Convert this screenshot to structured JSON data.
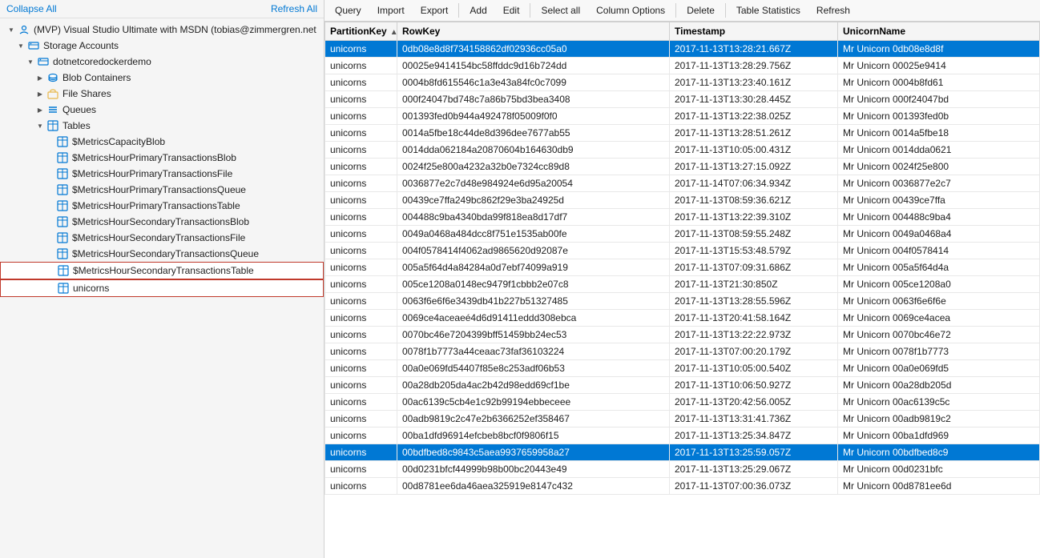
{
  "leftPanel": {
    "collapseAll": "Collapse All",
    "refreshAll": "Refresh All",
    "tree": [
      {
        "id": "mvp-account",
        "label": "(MVP) Visual Studio Ultimate with MSDN (tobias@zimmergren.net",
        "indent": 1,
        "icon": "account",
        "expanded": true,
        "hasArrow": true,
        "arrowDown": true
      },
      {
        "id": "storage-accounts",
        "label": "Storage Accounts",
        "indent": 2,
        "icon": "storage",
        "expanded": true,
        "hasArrow": true,
        "arrowDown": true
      },
      {
        "id": "dotnetcoredockerdemo",
        "label": "dotnetcoredockerdemo",
        "indent": 3,
        "icon": "storage",
        "expanded": true,
        "hasArrow": true,
        "arrowDown": true
      },
      {
        "id": "blob-containers",
        "label": "Blob Containers",
        "indent": 4,
        "icon": "blob",
        "expanded": false,
        "hasArrow": true,
        "arrowDown": false
      },
      {
        "id": "file-shares",
        "label": "File Shares",
        "indent": 4,
        "icon": "share",
        "expanded": false,
        "hasArrow": true,
        "arrowDown": false
      },
      {
        "id": "queues",
        "label": "Queues",
        "indent": 4,
        "icon": "queue",
        "expanded": false,
        "hasArrow": true,
        "arrowDown": false
      },
      {
        "id": "tables",
        "label": "Tables",
        "indent": 4,
        "icon": "table",
        "expanded": true,
        "hasArrow": true,
        "arrowDown": true
      },
      {
        "id": "t1",
        "label": "$MetricsCapacityBlob",
        "indent": 5,
        "icon": "table",
        "hasArrow": false
      },
      {
        "id": "t2",
        "label": "$MetricsHourPrimaryTransactionsBlob",
        "indent": 5,
        "icon": "table",
        "hasArrow": false
      },
      {
        "id": "t3",
        "label": "$MetricsHourPrimaryTransactionsFile",
        "indent": 5,
        "icon": "table",
        "hasArrow": false
      },
      {
        "id": "t4",
        "label": "$MetricsHourPrimaryTransactionsQueue",
        "indent": 5,
        "icon": "table",
        "hasArrow": false
      },
      {
        "id": "t5",
        "label": "$MetricsHourPrimaryTransactionsTable",
        "indent": 5,
        "icon": "table",
        "hasArrow": false
      },
      {
        "id": "t6",
        "label": "$MetricsHourSecondaryTransactionsBlob",
        "indent": 5,
        "icon": "table",
        "hasArrow": false
      },
      {
        "id": "t7",
        "label": "$MetricsHourSecondaryTransactionsFile",
        "indent": 5,
        "icon": "table",
        "hasArrow": false
      },
      {
        "id": "t8",
        "label": "$MetricsHourSecondaryTransactionsQueue",
        "indent": 5,
        "icon": "table",
        "hasArrow": false
      },
      {
        "id": "t9",
        "label": "$MetricsHourSecondaryTransactionsTable",
        "indent": 5,
        "icon": "table",
        "hasArrow": false,
        "selected": true
      },
      {
        "id": "unicorns",
        "label": "unicorns",
        "indent": 5,
        "icon": "table",
        "hasArrow": false,
        "highlighted": true
      }
    ]
  },
  "toolbar": {
    "buttons": [
      "Query",
      "Import",
      "Export",
      "Add",
      "Edit",
      "Select all",
      "Column Options",
      "Delete",
      "Table Statistics",
      "Refresh"
    ]
  },
  "table": {
    "columns": [
      {
        "id": "partition",
        "label": "PartitionKey",
        "sortable": true,
        "sortDir": "asc"
      },
      {
        "id": "rowkey",
        "label": "RowKey",
        "sortable": false
      },
      {
        "id": "timestamp",
        "label": "Timestamp",
        "sortable": false
      },
      {
        "id": "unicornname",
        "label": "UnicornName",
        "sortable": false
      }
    ],
    "rows": [
      {
        "partition": "unicorns",
        "rowkey": "0db08e8d8f734158862df02936cc05a0",
        "timestamp": "2017-11-13T13:28:21.667Z",
        "unicornname": "Mr Unicorn 0db08e8d8f",
        "selected": true
      },
      {
        "partition": "unicorns",
        "rowkey": "00025e9414154bc58ffddc9d16b724dd",
        "timestamp": "2017-11-13T13:28:29.756Z",
        "unicornname": "Mr Unicorn 00025e9414"
      },
      {
        "partition": "unicorns",
        "rowkey": "0004b8fd615546c1a3e43a84fc0c7099",
        "timestamp": "2017-11-13T13:23:40.161Z",
        "unicornname": "Mr Unicorn 0004b8fd61"
      },
      {
        "partition": "unicorns",
        "rowkey": "000f24047bd748c7a86b75bd3bea3408",
        "timestamp": "2017-11-13T13:30:28.445Z",
        "unicornname": "Mr Unicorn 000f24047bd"
      },
      {
        "partition": "unicorns",
        "rowkey": "001393fed0b944a492478f05009f0f0",
        "timestamp": "2017-11-13T13:22:38.025Z",
        "unicornname": "Mr Unicorn 001393fed0b"
      },
      {
        "partition": "unicorns",
        "rowkey": "0014a5fbe18c44de8d396dee7677ab55",
        "timestamp": "2017-11-13T13:28:51.261Z",
        "unicornname": "Mr Unicorn 0014a5fbe18"
      },
      {
        "partition": "unicorns",
        "rowkey": "0014dda062184a20870604b164630db9",
        "timestamp": "2017-11-13T10:05:00.431Z",
        "unicornname": "Mr Unicorn 0014dda0621"
      },
      {
        "partition": "unicorns",
        "rowkey": "0024f25e800a4232a32b0e7324cc89d8",
        "timestamp": "2017-11-13T13:27:15.092Z",
        "unicornname": "Mr Unicorn 0024f25e800"
      },
      {
        "partition": "unicorns",
        "rowkey": "0036877e2c7d48e984924e6d95a20054",
        "timestamp": "2017-11-14T07:06:34.934Z",
        "unicornname": "Mr Unicorn 0036877e2c7"
      },
      {
        "partition": "unicorns",
        "rowkey": "00439ce7ffa249bc862f29e3ba24925d",
        "timestamp": "2017-11-13T08:59:36.621Z",
        "unicornname": "Mr Unicorn 00439ce7ffa"
      },
      {
        "partition": "unicorns",
        "rowkey": "004488c9ba4340bda99f818ea8d17df7",
        "timestamp": "2017-11-13T13:22:39.310Z",
        "unicornname": "Mr Unicorn 004488c9ba4"
      },
      {
        "partition": "unicorns",
        "rowkey": "0049a0468a484dcc8f751e1535ab00fe",
        "timestamp": "2017-11-13T08:59:55.248Z",
        "unicornname": "Mr Unicorn 0049a0468a4"
      },
      {
        "partition": "unicorns",
        "rowkey": "004f0578414f4062ad9865620d92087e",
        "timestamp": "2017-11-13T15:53:48.579Z",
        "unicornname": "Mr Unicorn 004f0578414"
      },
      {
        "partition": "unicorns",
        "rowkey": "005a5f64d4a84284a0d7ebf74099a919",
        "timestamp": "2017-11-13T07:09:31.686Z",
        "unicornname": "Mr Unicorn 005a5f64d4a"
      },
      {
        "partition": "unicorns",
        "rowkey": "005ce1208a0148ec9479f1cbbb2e07c8",
        "timestamp": "2017-11-13T21:30:850Z",
        "unicornname": "Mr Unicorn 005ce1208a0"
      },
      {
        "partition": "unicorns",
        "rowkey": "0063f6e6f6e3439db41b227b51327485",
        "timestamp": "2017-11-13T13:28:55.596Z",
        "unicornname": "Mr Unicorn 0063f6e6f6e"
      },
      {
        "partition": "unicorns",
        "rowkey": "0069ce4aceaeé4d6d91411eddd308ebca",
        "timestamp": "2017-11-13T20:41:58.164Z",
        "unicornname": "Mr Unicorn 0069ce4acea"
      },
      {
        "partition": "unicorns",
        "rowkey": "0070bc46e7204399bff51459bb24ec53",
        "timestamp": "2017-11-13T13:22:22.973Z",
        "unicornname": "Mr Unicorn 0070bc46e72"
      },
      {
        "partition": "unicorns",
        "rowkey": "0078f1b7773a44ceaac73faf36103224",
        "timestamp": "2017-11-13T07:00:20.179Z",
        "unicornname": "Mr Unicorn 0078f1b7773"
      },
      {
        "partition": "unicorns",
        "rowkey": "00a0e069fd54407f85e8c253adf06b53",
        "timestamp": "2017-11-13T10:05:00.540Z",
        "unicornname": "Mr Unicorn 00a0e069fd5"
      },
      {
        "partition": "unicorns",
        "rowkey": "00a28db205da4ac2b42d98edd69cf1be",
        "timestamp": "2017-11-13T10:06:50.927Z",
        "unicornname": "Mr Unicorn 00a28db205d"
      },
      {
        "partition": "unicorns",
        "rowkey": "00ac6139c5cb4e1c92b99194ebbeceee",
        "timestamp": "2017-11-13T20:42:56.005Z",
        "unicornname": "Mr Unicorn 00ac6139c5c"
      },
      {
        "partition": "unicorns",
        "rowkey": "00adb9819c2c47e2b6366252ef358467",
        "timestamp": "2017-11-13T13:31:41.736Z",
        "unicornname": "Mr Unicorn 00adb9819c2"
      },
      {
        "partition": "unicorns",
        "rowkey": "00ba1dfd96914efcbeb8bcf0f9806f15",
        "timestamp": "2017-11-13T13:25:34.847Z",
        "unicornname": "Mr Unicorn 00ba1dfd969"
      },
      {
        "partition": "unicorns",
        "rowkey": "00bdfbed8c9843c5aea9937659958a27",
        "timestamp": "2017-11-13T13:25:59.057Z",
        "unicornname": "Mr Unicorn 00bdfbed8c9",
        "selected": true
      },
      {
        "partition": "unicorns",
        "rowkey": "00d0231bfcf44999b98b00bc20443e49",
        "timestamp": "2017-11-13T13:25:29.067Z",
        "unicornname": "Mr Unicorn 00d0231bfc"
      },
      {
        "partition": "unicorns",
        "rowkey": "00d8781ee6da46aea325919e8147c432",
        "timestamp": "2017-11-13T07:00:36.073Z",
        "unicornname": "Mr Unicorn 00d8781ee6d"
      }
    ]
  }
}
